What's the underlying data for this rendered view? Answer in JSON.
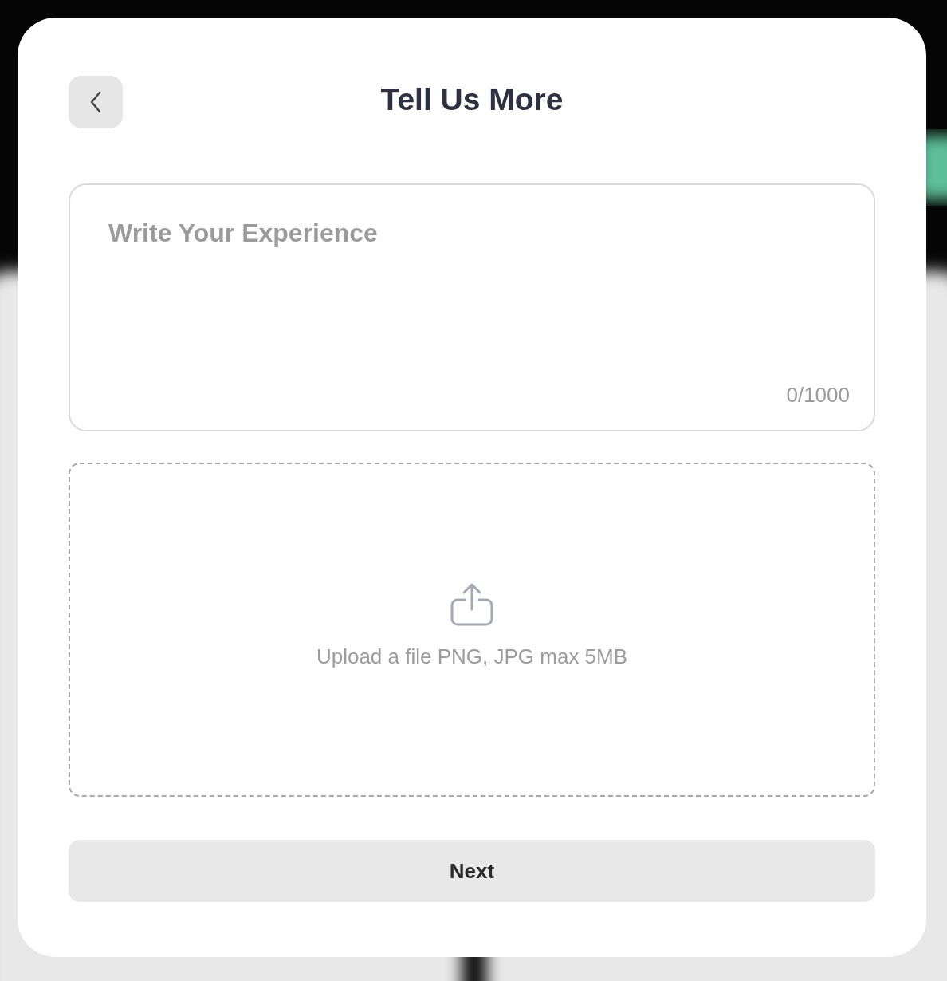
{
  "dialog": {
    "title": "Tell Us More"
  },
  "experience_field": {
    "placeholder": "Write Your Experience",
    "counter": "0/1000"
  },
  "upload_area": {
    "label": "Upload a file PNG, JPG max 5MB"
  },
  "next_button": {
    "label": "Next"
  }
}
